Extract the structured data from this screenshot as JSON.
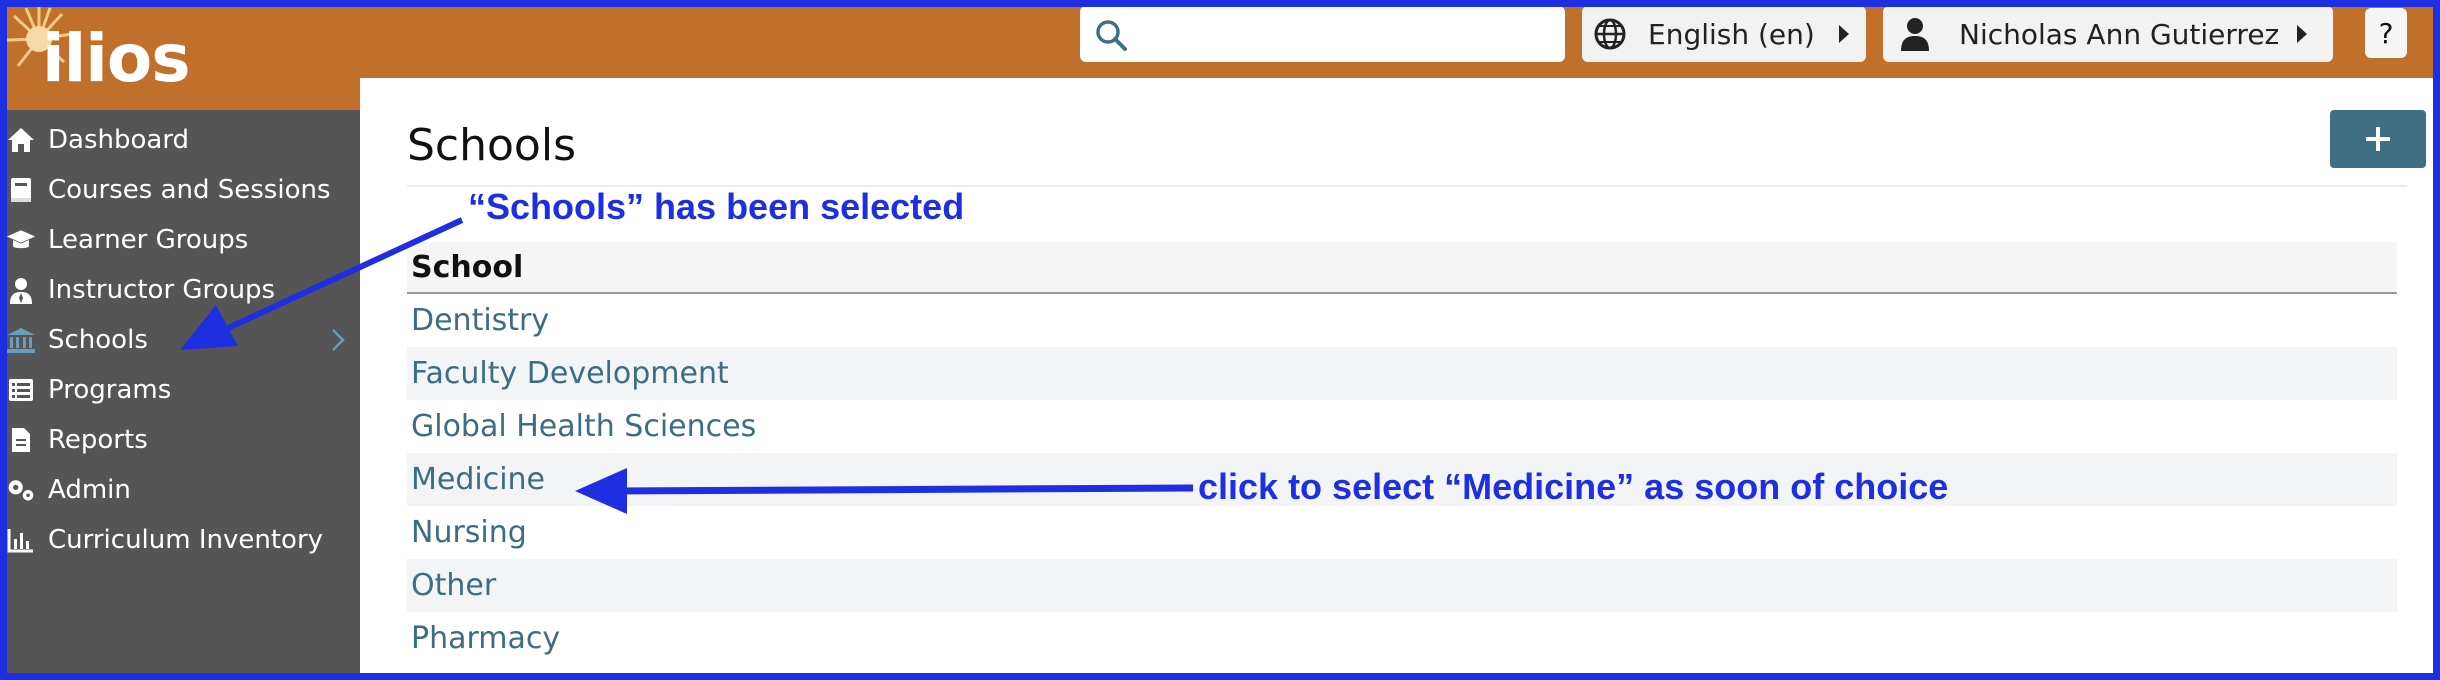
{
  "app": {
    "logo_text": "ilios"
  },
  "header": {
    "search": {
      "value": "",
      "placeholder": ""
    },
    "language_label": "English (en)",
    "user_name": "Nicholas Ann Gutierrez",
    "help_label": "?"
  },
  "sidebar": {
    "items": [
      {
        "label": "Dashboard",
        "icon": "home-icon"
      },
      {
        "label": "Courses and Sessions",
        "icon": "book-icon"
      },
      {
        "label": "Learner Groups",
        "icon": "graduation-cap-icon"
      },
      {
        "label": "Instructor Groups",
        "icon": "user-tie-icon"
      },
      {
        "label": "Schools",
        "icon": "university-icon",
        "active": true
      },
      {
        "label": "Programs",
        "icon": "list-icon"
      },
      {
        "label": "Reports",
        "icon": "file-icon"
      },
      {
        "label": "Admin",
        "icon": "cogs-icon"
      },
      {
        "label": "Curriculum Inventory",
        "icon": "chart-icon"
      }
    ]
  },
  "main": {
    "title": "Schools",
    "add_label": "+",
    "table": {
      "header": "School",
      "rows": [
        "Dentistry",
        "Faculty Development",
        "Global Health Sciences",
        "Medicine",
        "Nursing",
        "Other",
        "Pharmacy"
      ]
    }
  },
  "annotations": {
    "schools_selected": "“Schools” has been selected",
    "medicine_hint": "click to select “Medicine” as soon of choice"
  },
  "colors": {
    "header_bg": "#c0702a",
    "sidebar_bg": "#555555",
    "link": "#3b6d84",
    "accent_button": "#3f6e85",
    "annotation": "#1d2fe0"
  }
}
